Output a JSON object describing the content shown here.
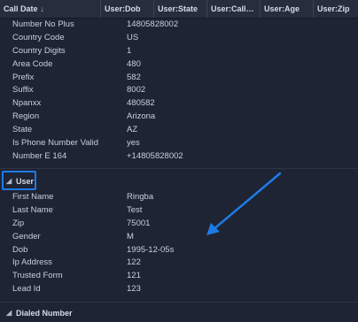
{
  "columns": [
    {
      "label": "Call Date",
      "sort": "↓"
    },
    {
      "label": "User:Dob"
    },
    {
      "label": "User:State"
    },
    {
      "label": "User:Call…"
    },
    {
      "label": "User:Age"
    },
    {
      "label": "User:Zip"
    }
  ],
  "phone_rows": [
    {
      "key": "Number No Plus",
      "value": "14805828002"
    },
    {
      "key": "Country Code",
      "value": "US"
    },
    {
      "key": "Country Digits",
      "value": "1"
    },
    {
      "key": "Area Code",
      "value": "480"
    },
    {
      "key": "Prefix",
      "value": "582"
    },
    {
      "key": "Suffix",
      "value": "8002"
    },
    {
      "key": "Npanxx",
      "value": "480582"
    },
    {
      "key": "Region",
      "value": "Arizona"
    },
    {
      "key": "State",
      "value": "AZ"
    },
    {
      "key": "Is Phone Number Valid",
      "value": "yes"
    },
    {
      "key": "Number E 164",
      "value": "+14805828002"
    }
  ],
  "user_section": {
    "label": "User",
    "rows": [
      {
        "key": "First Name",
        "value": "Ringba"
      },
      {
        "key": "Last Name",
        "value": "Test"
      },
      {
        "key": "Zip",
        "value": "75001"
      },
      {
        "key": "Gender",
        "value": "M"
      },
      {
        "key": "Dob",
        "value": "1995-12-05s"
      },
      {
        "key": "Ip Address",
        "value": "122"
      },
      {
        "key": "Trusted Form",
        "value": "121"
      },
      {
        "key": "Lead Id",
        "value": "123"
      }
    ]
  },
  "dialed_section": {
    "label": "Dialed Number"
  },
  "colors": {
    "background": "#1e2433",
    "header": "#262d3d",
    "annotation": "#1e7be6"
  }
}
